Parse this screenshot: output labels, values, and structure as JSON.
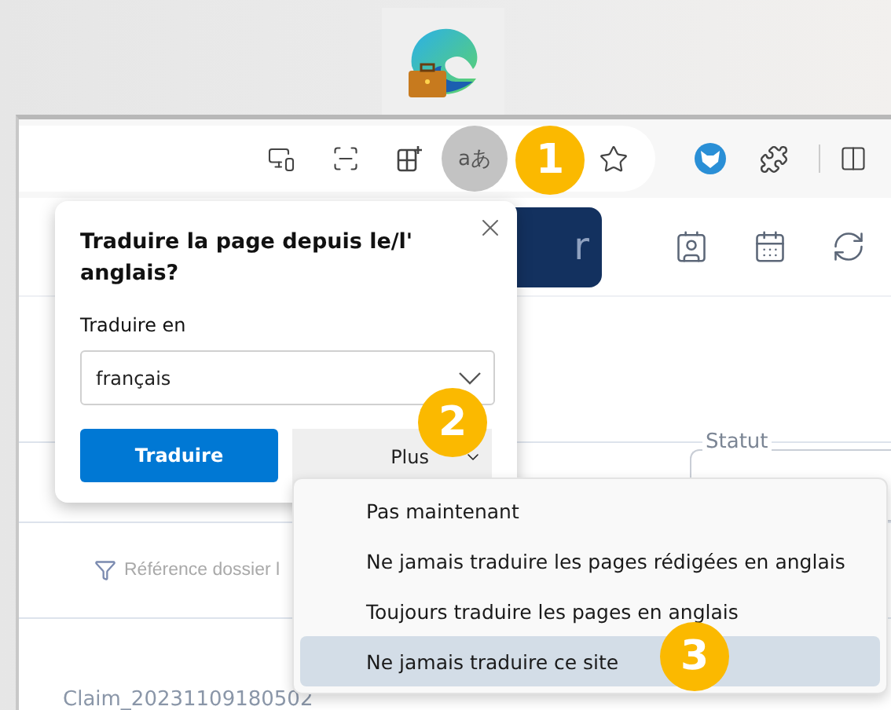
{
  "toolbar": {
    "translate_button": {
      "label": "aあ",
      "active": true
    }
  },
  "page": {
    "header_button": "r",
    "filter_label": "Référence dossier l",
    "status_label": "Statut",
    "row_text": "Claim_20231109180502"
  },
  "translate_popup": {
    "title": "Traduire la page depuis le/l' anglais?",
    "target_label": "Traduire en",
    "target_value": "français",
    "primary_button": "Traduire",
    "more_button": "Plus"
  },
  "more_menu": [
    {
      "label": "Pas maintenant",
      "selected": false
    },
    {
      "label": "Ne jamais traduire les pages rédigées en anglais",
      "selected": false
    },
    {
      "label": "Toujours traduire les pages en anglais",
      "selected": false
    },
    {
      "label": "Ne jamais traduire ce site",
      "selected": true
    }
  ],
  "callouts": [
    "1",
    "2",
    "3"
  ]
}
